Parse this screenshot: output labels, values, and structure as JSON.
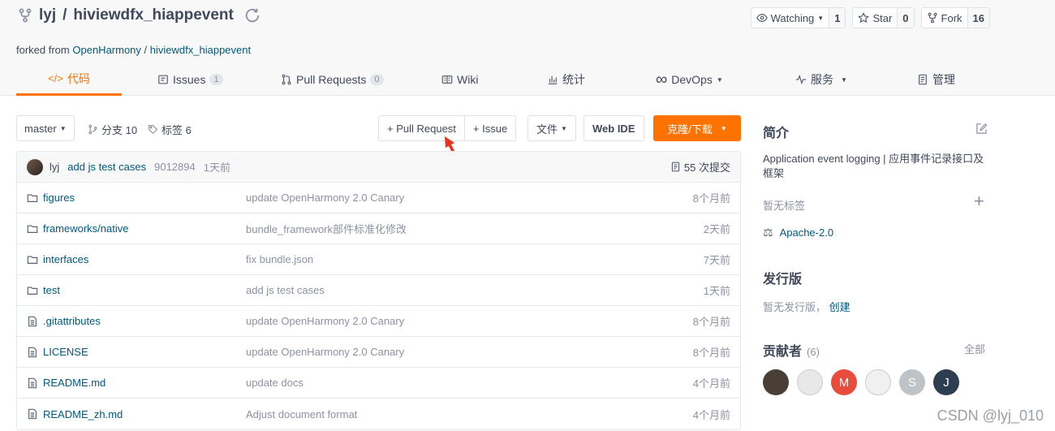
{
  "repo": {
    "owner": "lyj",
    "slash": "/",
    "name": "hiviewdfx_hiappevent",
    "forked_prefix": "forked from",
    "forked_owner": "OpenHarmony",
    "forked_name": "hiviewdfx_hiappevent"
  },
  "actions": [
    {
      "label": "Watching",
      "count": "1",
      "icon": "eye-icon"
    },
    {
      "label": "Star",
      "count": "0",
      "icon": "star-icon"
    },
    {
      "label": "Fork",
      "count": "16",
      "icon": "fork-icon"
    }
  ],
  "tabs": [
    {
      "label": "代码",
      "icon": "code-icon",
      "active": true
    },
    {
      "label": "Issues",
      "badge": "1",
      "icon": "issue-icon"
    },
    {
      "label": "Pull Requests",
      "badge": "0",
      "icon": "pull-request-icon"
    },
    {
      "label": "Wiki",
      "icon": "book-icon"
    },
    {
      "label": "统计",
      "icon": "bar-chart-icon"
    },
    {
      "label": "DevOps",
      "icon": "infinity-icon"
    },
    {
      "label": "服务",
      "icon": "pulse-icon"
    },
    {
      "label": "管理",
      "icon": "document-icon"
    }
  ],
  "toolbar": {
    "branch": "master",
    "branches": "分支 10",
    "tags": "标签 6",
    "pull_request": "+ Pull Request",
    "issue": "+ Issue",
    "file": "文件",
    "web_ide": "Web IDE",
    "clone": "克隆/下载"
  },
  "commit": {
    "author": "lyj",
    "message": "add js test cases",
    "hash": "9012894",
    "time": "1天前",
    "count": "55 次提交"
  },
  "files": [
    {
      "name": "figures",
      "type": "folder",
      "message": "update OpenHarmony 2.0 Canary",
      "time": "8个月前"
    },
    {
      "name": "frameworks/native",
      "type": "folder",
      "message": "bundle_framework部件标准化修改",
      "time": "2天前"
    },
    {
      "name": "interfaces",
      "type": "folder",
      "message": "fix bundle.json",
      "time": "7天前"
    },
    {
      "name": "test",
      "type": "folder",
      "message": "add js test cases",
      "time": "1天前"
    },
    {
      "name": ".gitattributes",
      "type": "file",
      "message": "update OpenHarmony 2.0 Canary",
      "time": "8个月前"
    },
    {
      "name": "LICENSE",
      "type": "file",
      "message": "update OpenHarmony 2.0 Canary",
      "time": "8个月前"
    },
    {
      "name": "README.md",
      "type": "file",
      "message": "update docs",
      "time": "4个月前"
    },
    {
      "name": "README_zh.md",
      "type": "file",
      "message": "Adjust document format",
      "time": "4个月前"
    }
  ],
  "sidebar": {
    "intro_title": "简介",
    "intro_text": "Application event logging | 应用事件记录接口及框架",
    "no_tags": "暂无标签",
    "license": "Apache-2.0",
    "release_title": "发行版",
    "no_release": "暂无发行版，",
    "create": "创建",
    "contributors_title": "贡献者",
    "contributors_count": "(6)",
    "all": "全部",
    "avatars": [
      {
        "letter": "",
        "color": "#4a3f35"
      },
      {
        "letter": "",
        "color": "#e8e8e8"
      },
      {
        "letter": "M",
        "color": "#e74c3c"
      },
      {
        "letter": "",
        "color": "#f0f0f0"
      },
      {
        "letter": "S",
        "color": "#bdc3c7"
      },
      {
        "letter": "J",
        "color": "#2c3e50"
      }
    ]
  },
  "watermark": "CSDN @lyj_010",
  "colors": {
    "accent": "#fe7300",
    "link": "#005980",
    "arrow": "#e8321e"
  }
}
